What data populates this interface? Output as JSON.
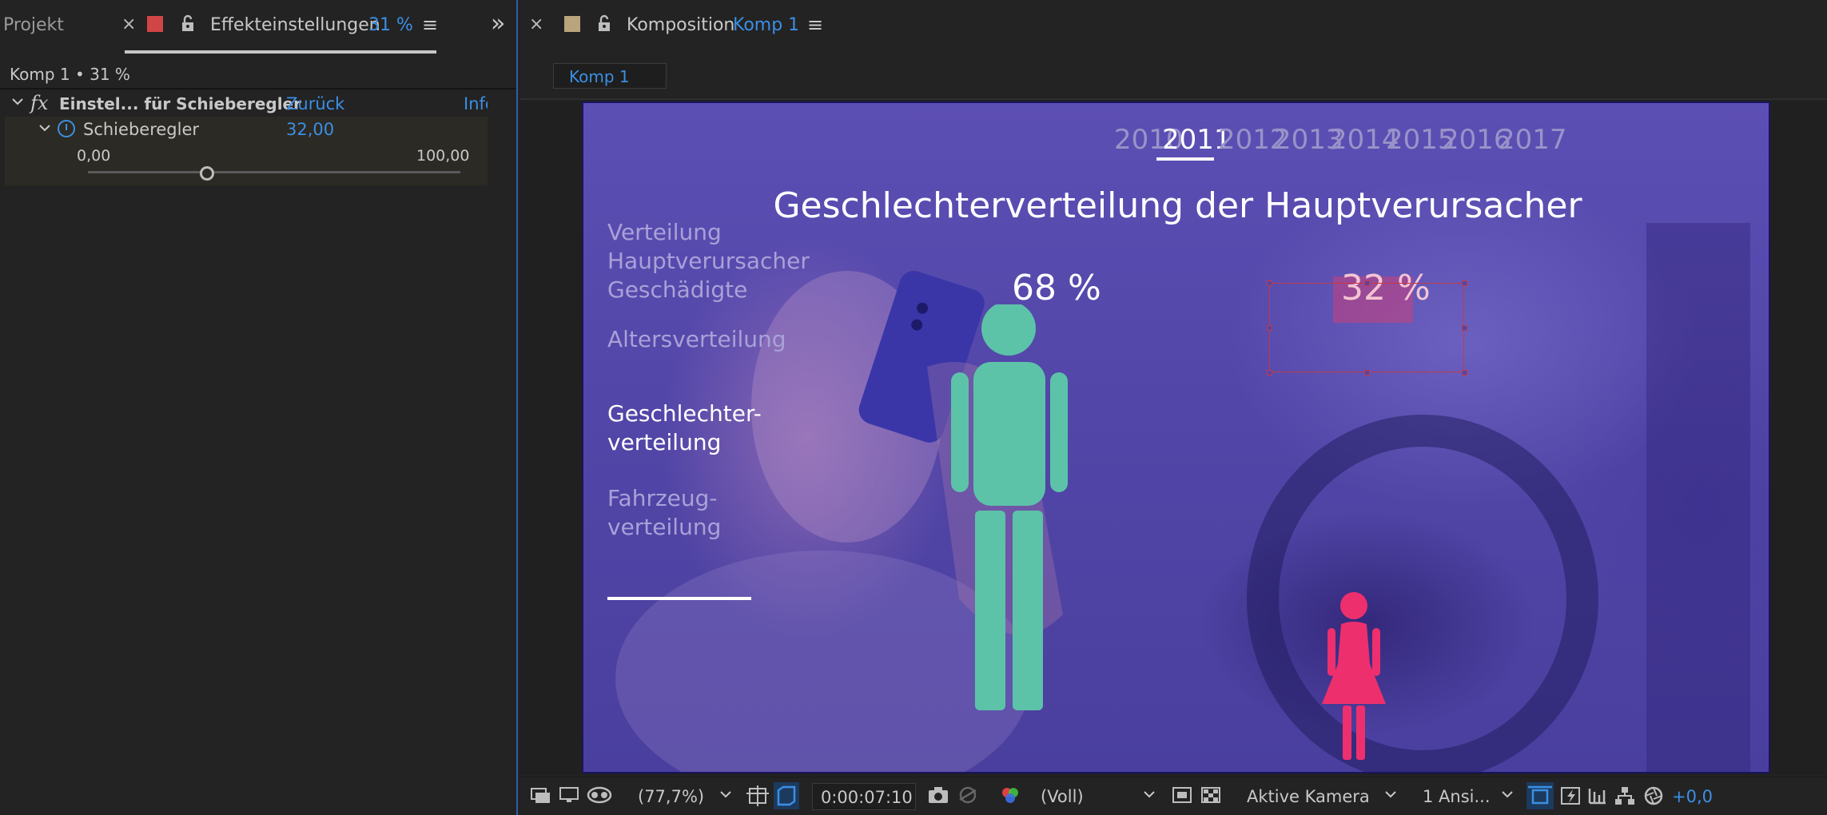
{
  "left_panel": {
    "tabs": {
      "project_label": "Projekt",
      "close_glyph": "×",
      "effects_label": "Effekteinstellungen",
      "effects_zoom": "31 %",
      "menu_glyph": "≡",
      "overflow_glyph": "»"
    },
    "comp_path": "Komp 1 • 31 %",
    "effect": {
      "fx_label": "fx",
      "name": "Einstel... für Schieberegler",
      "reset_label": "Zurück",
      "info_label": "Info",
      "property": {
        "label": "Schieberegler",
        "value": "32,00",
        "min_label": "0,00",
        "max_label": "100,00",
        "slider_fraction": 0.32
      }
    },
    "accent_color": "#3b8fe4",
    "label_color": "#d04545"
  },
  "right_panel": {
    "tab": {
      "close_glyph": "×",
      "label": "Komposition",
      "comp_name": "Komp 1",
      "menu_glyph": "≡",
      "label_color": "#b9a47c"
    },
    "comp_button": "Komp 1"
  },
  "canvas": {
    "years": [
      "2010",
      "2011",
      "2012",
      "2013",
      "2014",
      "2015",
      "2016",
      "2017"
    ],
    "active_year": "2011",
    "headline": "Geschlechterverteilung der Hauptverursacher",
    "nav": {
      "item1_lines": [
        "Verteilung",
        "Hauptverursacher",
        "Geschädigte"
      ],
      "item2": "Altersverteilung",
      "item3_lines": [
        "Geschlechter-",
        "verteilung"
      ],
      "item4_lines": [
        "Fahrzeug-",
        "verteilung"
      ]
    },
    "male_percent": "68 %",
    "female_percent": "32 %",
    "colors": {
      "male": "#5cc3a8",
      "female": "#ee2f6d",
      "overlay": "#5246a8"
    }
  },
  "toolbar": {
    "zoom": "(77,7%)",
    "timecode": "0:00:07:10",
    "resolution": "(Voll)",
    "camera": "Aktive Kamera",
    "views": "1 Ansi...",
    "exposure": "+0,0"
  }
}
